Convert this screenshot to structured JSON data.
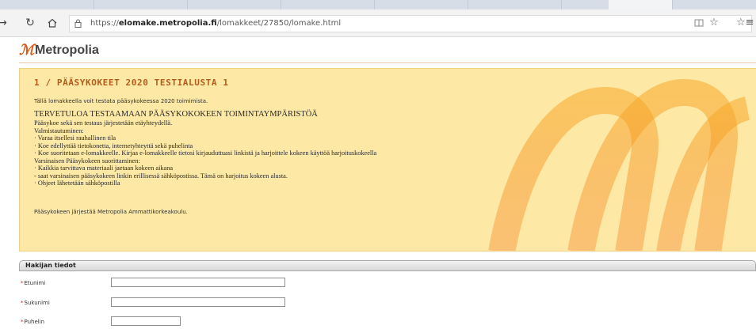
{
  "browser": {
    "url_prefix": "https://",
    "url_domain": "elomake.metropolia.fi",
    "url_path": "/lomakkeet/27850/lomake.html",
    "icons": [
      "back-arrow-icon",
      "refresh-icon",
      "home-icon",
      "lock-icon",
      "reading-view-icon",
      "favorite-star-icon",
      "favorites-list-icon"
    ]
  },
  "site": {
    "logo_text": "Metropolia",
    "brand_color": "#e05a15"
  },
  "info": {
    "title": "1 / PÄÄSYKOKEET 2020 TESTIALUSTA 1",
    "intro": "Tällä lomakkeella voit testata pääsykokeessa 2020 toimimista.",
    "heading": "TERVETULOA TESTAAMAAN PÄÄSYKOKOKEEN TOIMINTAYMPÄRISTÖÄ",
    "lines": [
      "Pääsykoe sekä sen testaus järjestetään etäyhteydellä.",
      "Valmistautuminen:",
      "· Varaa itsellesi rauhallinen tila",
      "· Koe edellyttää tietokonetta, internetyhteyttä sekä puhelinta",
      "· Koe suoritetaan e-lomakkeelle. Kirjaa e-lomakkeelle tietosi kirjauduttuasi linkistä ja harjoittele kokeen käyttöä harjoituskokeella",
      "Varsinaisen Pääsykokeen suorittaminen:",
      "· Kaikkia tarvittava materiaali jaetaan kokeen aikana",
      "- saat varsinaisen pääsykokeen linkin erillisessä sähköpostissa. Tämä on harjoitus kokeen alusta.",
      "· Ohjeet lähetetään sähköpostilla"
    ],
    "footer": "Pääsykokeen järjestää Metropolia Ammattikorkeakoulu."
  },
  "form": {
    "section_title": "Hakijan tiedot",
    "required_mark": "*",
    "fields": [
      {
        "label": "Etunimi",
        "value": ""
      },
      {
        "label": "Sukunimi",
        "value": ""
      },
      {
        "label": "Puhelin",
        "value": ""
      }
    ]
  }
}
